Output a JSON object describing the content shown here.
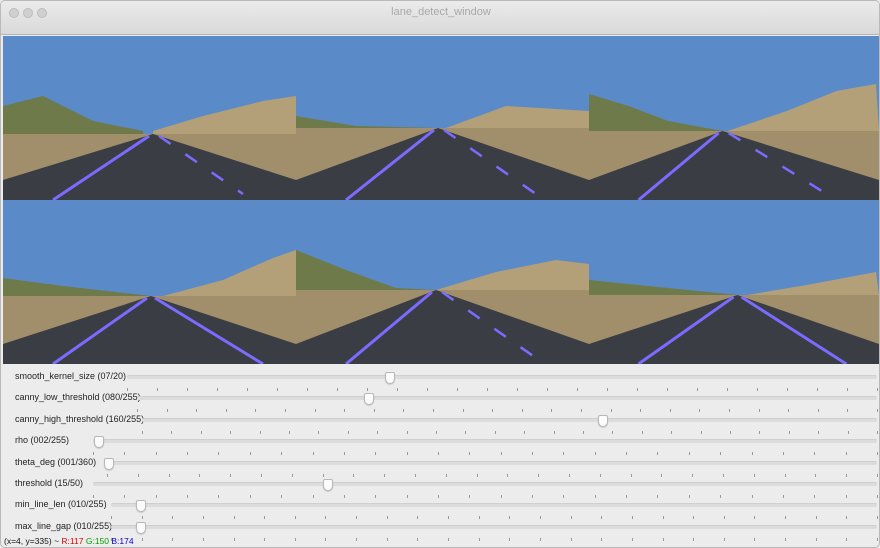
{
  "window": {
    "title": "lane_detect_window"
  },
  "images": [
    {
      "name": "road-frame-1"
    },
    {
      "name": "road-frame-2"
    },
    {
      "name": "road-frame-3"
    },
    {
      "name": "road-frame-4"
    },
    {
      "name": "road-frame-5"
    },
    {
      "name": "road-frame-6"
    }
  ],
  "trackbars": [
    {
      "label": "smooth_kernel_size (07/20)",
      "value": 7,
      "max": 20
    },
    {
      "label": "canny_low_threshold (080/255)",
      "value": 80,
      "max": 255
    },
    {
      "label": "canny_high_threshold (160/255)",
      "value": 160,
      "max": 255
    },
    {
      "label": "rho         (002/255)",
      "value": 2,
      "max": 255
    },
    {
      "label": "theta_deg  (001/360)",
      "value": 1,
      "max": 360
    },
    {
      "label": "threshold  (15/50)",
      "value": 15,
      "max": 50
    },
    {
      "label": "min_line_len  (010/255)",
      "value": 10,
      "max": 255
    },
    {
      "label": "max_line_gap  (010/255)",
      "value": 10,
      "max": 255
    }
  ],
  "status": {
    "coords": "(x=4, y=335) ~",
    "r": "R:117",
    "g": "G:150",
    "b": "B:174"
  },
  "colors": {
    "lane_marking": "#7b6cff",
    "sky": "#5b8ac9",
    "road": "#3b3d45"
  }
}
